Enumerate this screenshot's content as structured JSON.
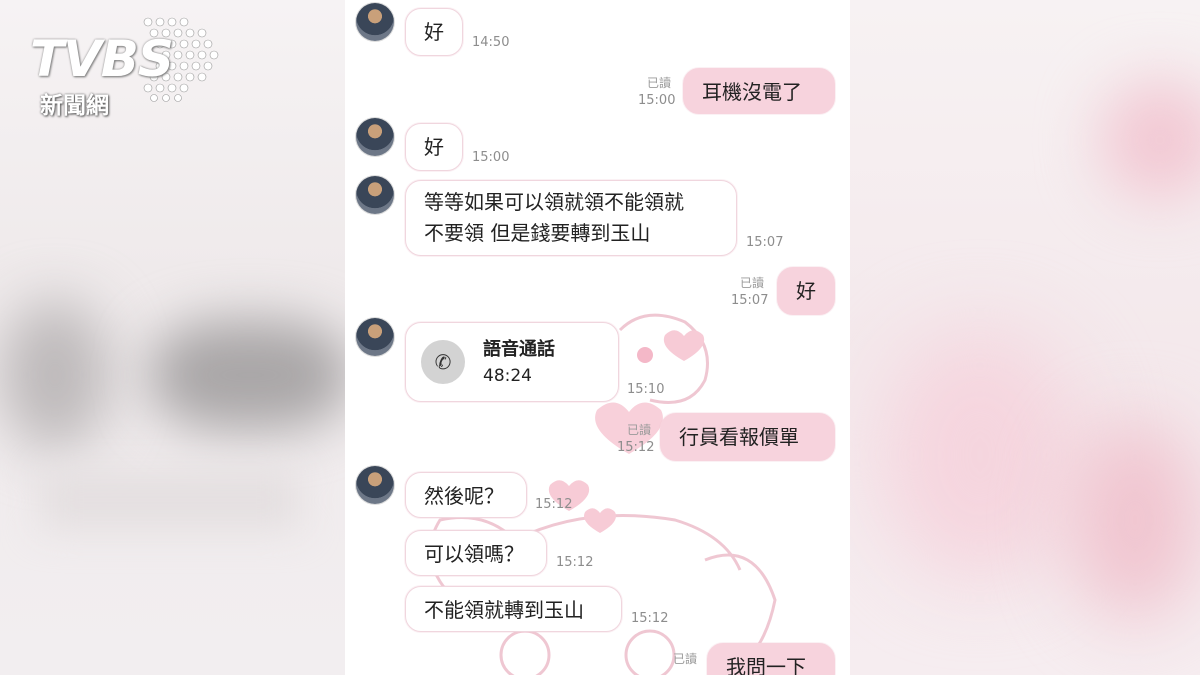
{
  "logo": {
    "brand": "TVBS",
    "subtitle": "新聞網"
  },
  "messages": [
    {
      "text": "好",
      "time": "14:50"
    },
    {
      "text": "耳機沒電了",
      "read": "已讀",
      "time": "15:00"
    },
    {
      "text": "好",
      "time": "15:00"
    },
    {
      "line1": "等等如果可以領就領不能領就",
      "line2": "不要領 但是錢要轉到玉山",
      "time": "15:07"
    },
    {
      "text": "好",
      "read": "已讀",
      "time": "15:07"
    },
    {
      "call_label": "語音通話",
      "duration": "48:24",
      "time": "15:10"
    },
    {
      "text": "行員看報價單",
      "read": "已讀",
      "time": "15:12"
    },
    {
      "text": "然後呢？",
      "time": "15:12"
    },
    {
      "text": "可以領嗎？",
      "time": "15:12"
    },
    {
      "text": "不能領就轉到玉山",
      "time": "15:12"
    },
    {
      "text": "我問一下",
      "read": "已讀"
    }
  ],
  "colors": {
    "outgoing_bubble": "#f7d3dd",
    "incoming_bubble": "#ffffff",
    "chat_bg": "#ffffff"
  }
}
